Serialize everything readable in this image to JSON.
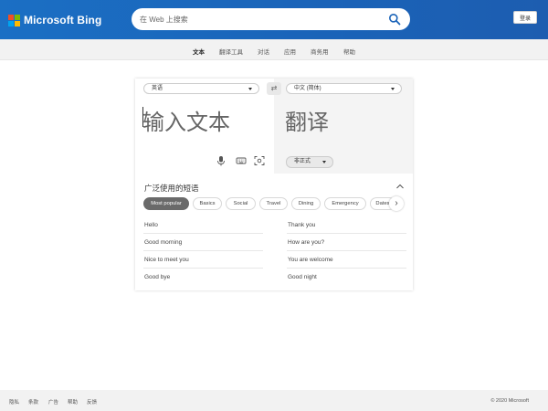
{
  "header": {
    "brand": "Microsoft Bing",
    "logo_colors": [
      "#f25022",
      "#7fba00",
      "#00a4ef",
      "#ffb900"
    ],
    "search_placeholder": "在 Web 上搜索",
    "search_icon": "search-icon",
    "login_label": "登录"
  },
  "nav": {
    "items": [
      "文本",
      "翻译工具",
      "对话",
      "应用",
      "商务用",
      "帮助"
    ]
  },
  "translator": {
    "source_lang": "英语",
    "target_lang": "中文 (简体)",
    "swap_icon": "⇄",
    "source_placeholder": "输入文本",
    "target_placeholder": "翻译",
    "tone": "非正式",
    "icons": [
      "microphone-icon",
      "keyboard-icon",
      "camera-scan-icon"
    ]
  },
  "phrases": {
    "title": "广泛使用的短语",
    "categories": [
      "Most popular",
      "Basics",
      "Social",
      "Travel",
      "Dining",
      "Emergency",
      "Dates"
    ],
    "selected_category": "Most popular",
    "left": [
      "Hello",
      "Good morning",
      "Nice to meet you",
      "Good bye"
    ],
    "right": [
      "Thank you",
      "How are you?",
      "You are welcome",
      "Good night"
    ]
  },
  "footer": {
    "links": [
      "隐私",
      "条款",
      "广告",
      "帮助",
      "反馈"
    ],
    "copyright": "© 2020 Microsoft"
  }
}
